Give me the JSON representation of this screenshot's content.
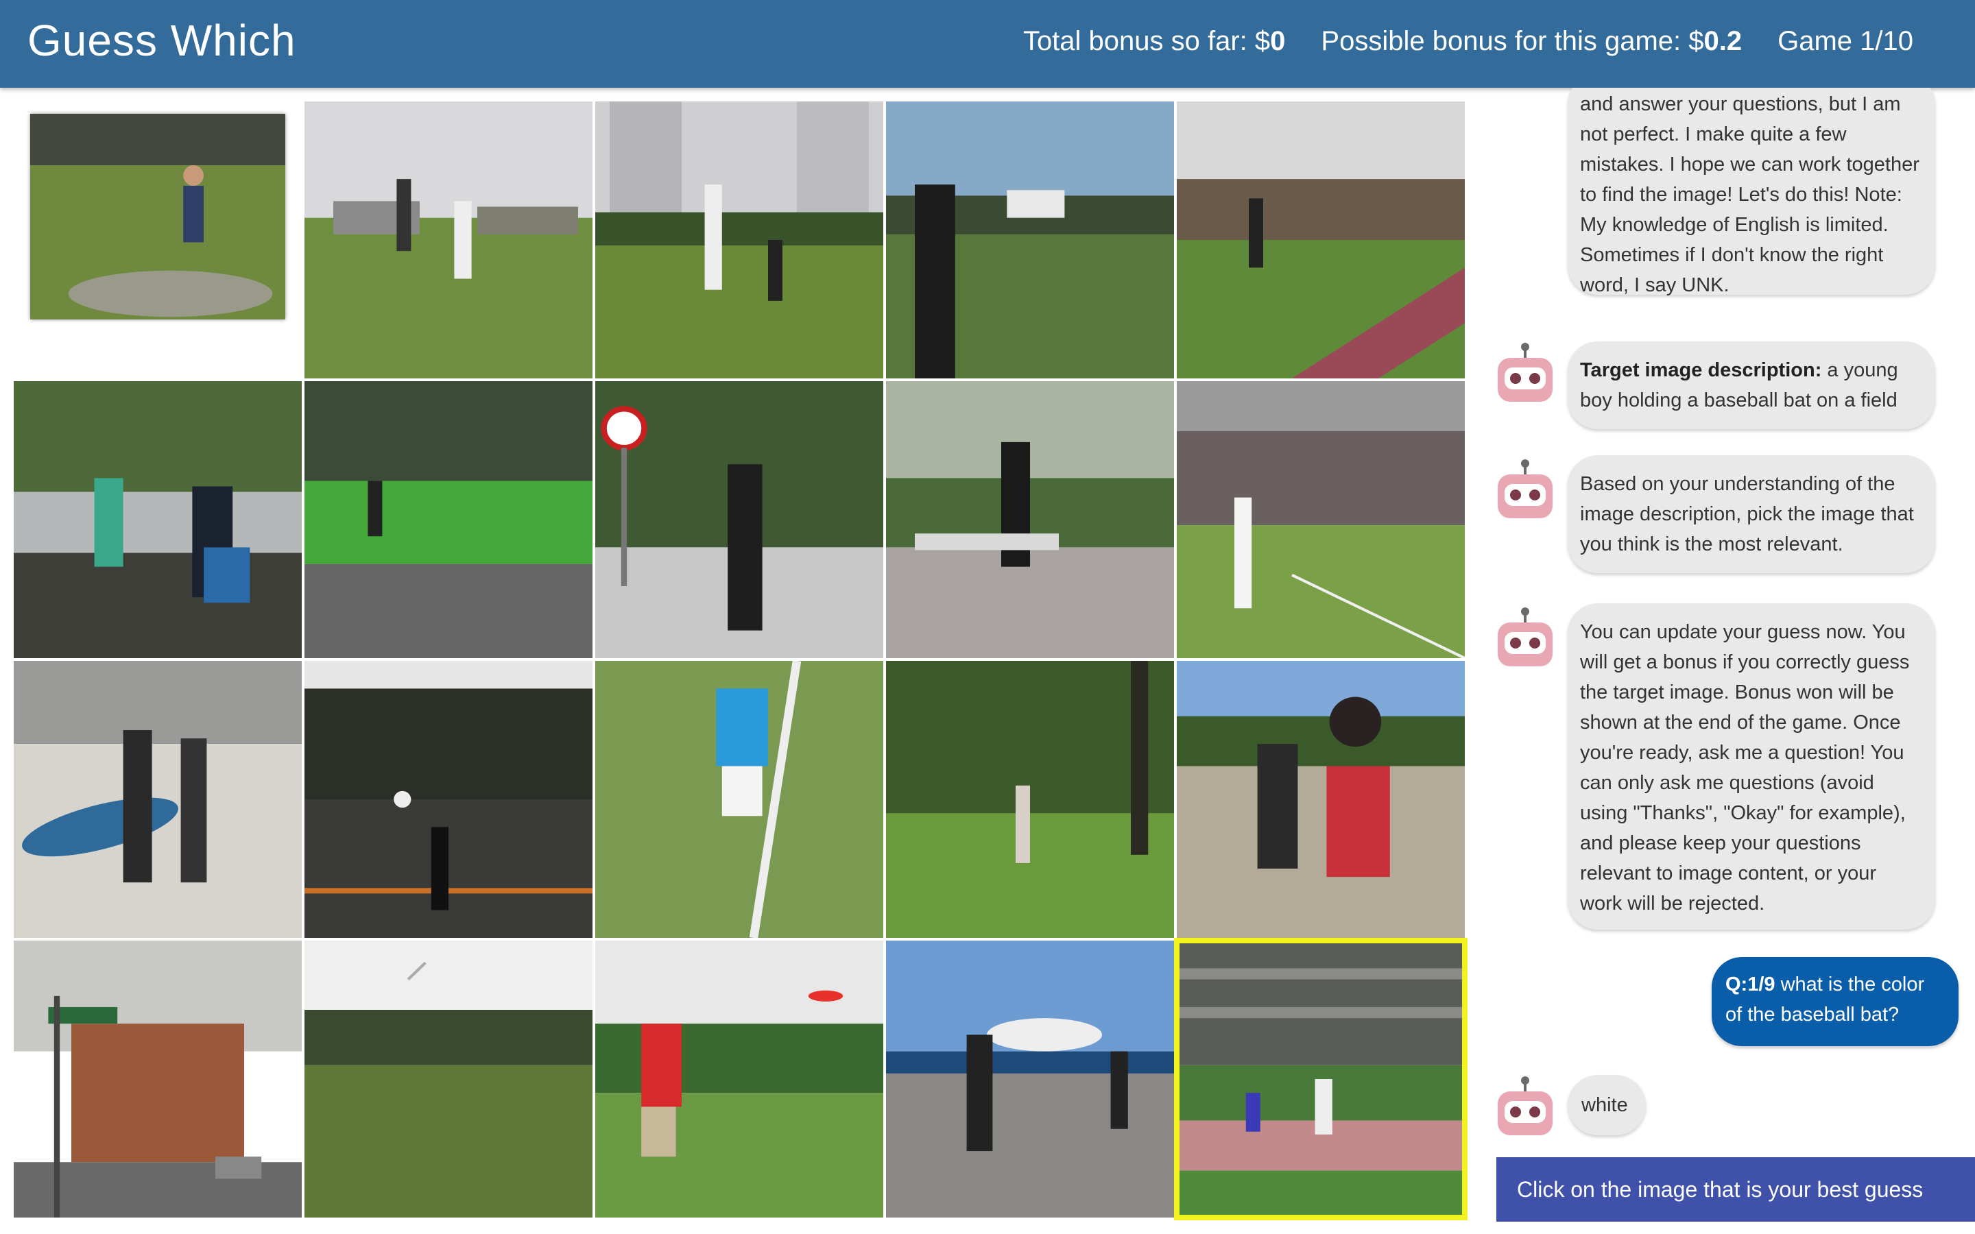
{
  "header": {
    "title": "Guess Which",
    "total_bonus_label": "Total bonus so far: $",
    "total_bonus_value": "0",
    "possible_bonus_label": "Possible bonus for this game: $",
    "possible_bonus_value": "0.2",
    "game_progress": "Game 1/10"
  },
  "colors": {
    "header_bg": "#336b9a",
    "bot_bubble": "#e9e9e9",
    "user_bubble": "#0a5da8",
    "selection_outline": "#f2f21e",
    "instruction_bar": "#3f51a8",
    "robot_pink": "#e9a7b4"
  },
  "grid": {
    "rows": 4,
    "columns": 5,
    "selected_index": 19
  },
  "chat": {
    "intro_partial": "and answer your questions, but I am not perfect. I make quite a few mistakes. I hope we can work together to find the image! Let's do this! Note: My knowledge of English is limited. Sometimes if I don't know the right word, I say UNK.",
    "target_label": "Target image description:",
    "target_text": " a young boy holding a baseball bat on a field",
    "pick_text": "Based on your understanding of the image description, pick the image that you think is the most relevant.",
    "update_text": "You can update your guess now. You will get a bonus if you correctly guess the target image. Bonus won will be shown at the end of the game. Once you're ready, ask me a question! You can only ask me questions (avoid using \"Thanks\", \"Okay\" for example), and please keep your questions relevant to image content, or your work will be rejected.",
    "question_label": "Q:1/9",
    "question_text": " what is the color of the baseball bat?",
    "answer_text": "white"
  },
  "instruction": "Click on the image that is your best guess",
  "icons": {
    "bot_avatar": "robot-icon"
  }
}
